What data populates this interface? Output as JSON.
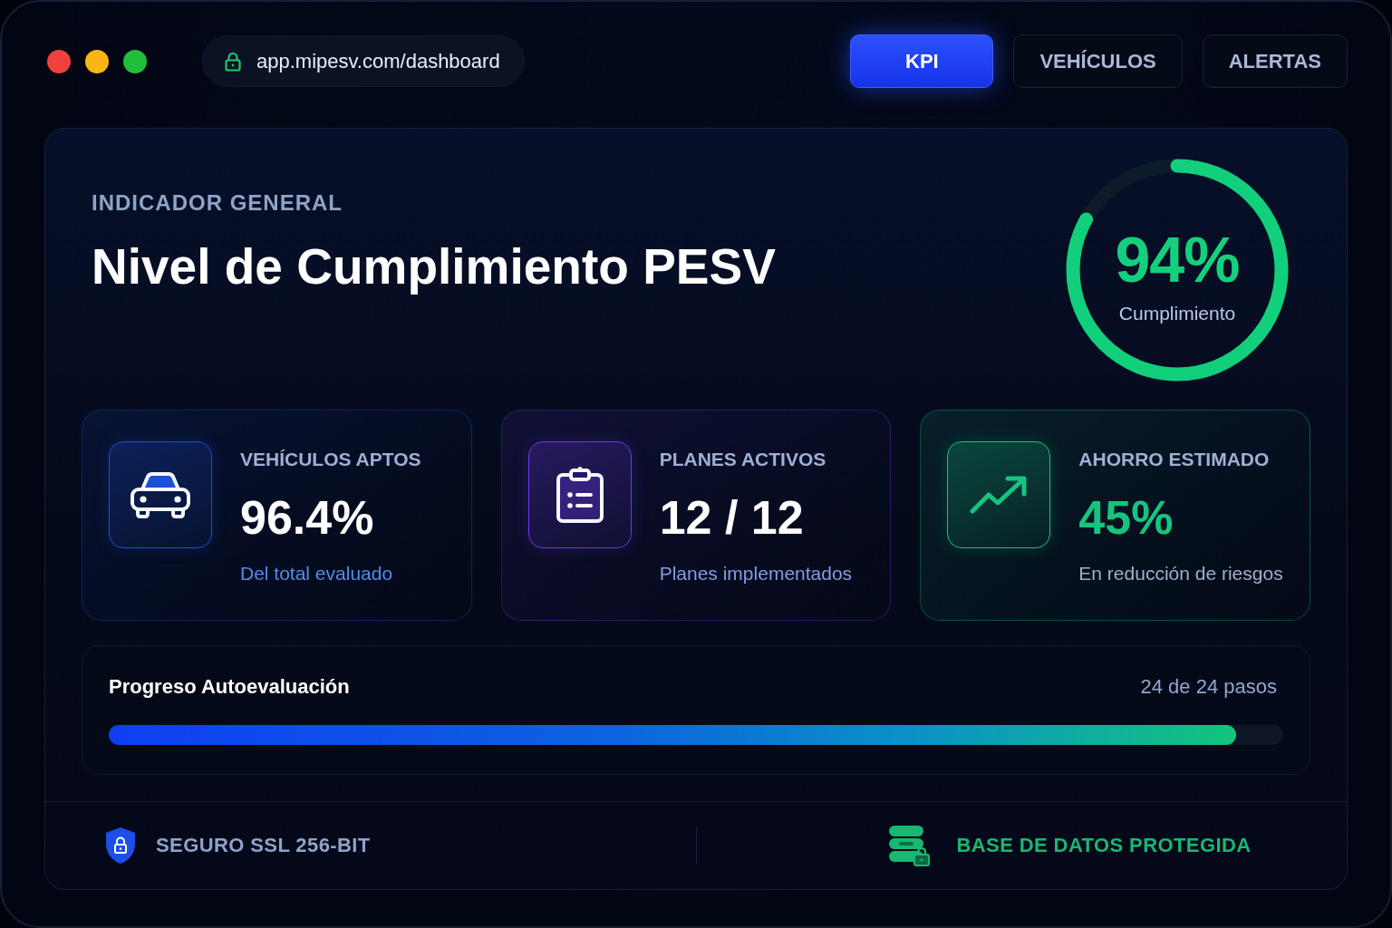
{
  "address_bar": {
    "url": "app.mipesv.com/dashboard"
  },
  "tabs": [
    {
      "label": "KPI",
      "selected": true
    },
    {
      "label": "VEHÍCULOS",
      "selected": false
    },
    {
      "label": "ALERTAS",
      "selected": false
    }
  ],
  "header": {
    "eyebrow": "INDICADOR GENERAL",
    "title": "Nivel de Cumplimiento PESV"
  },
  "gauge": {
    "value": "94%",
    "label": "Cumplimiento",
    "level": 0.83
  },
  "cards": [
    {
      "label": "VEHÍCULOS APTOS",
      "value": "96.4%",
      "caption": "Del total evaluado",
      "color": "#1d4fd8",
      "accent_value": false
    },
    {
      "label": "PLANES ACTIVOS",
      "value": "12 / 12",
      "caption": "Planes implementados",
      "color": "#6a3ae8",
      "accent_value": false
    },
    {
      "label": "AHORRO ESTIMADO",
      "value": "45%",
      "caption": "En reducción de riesgos",
      "color": "#16c47f",
      "accent_value": true
    }
  ],
  "progress": {
    "title": "Progreso Autoevaluación",
    "reading": "24 de 24 pasos",
    "level": 0.96
  },
  "footer": [
    {
      "kind": "security",
      "label": "SEGURO SSL 256-BIT"
    },
    {
      "kind": "database",
      "label": "BASE DE DATOS PROTEGIDA"
    }
  ]
}
